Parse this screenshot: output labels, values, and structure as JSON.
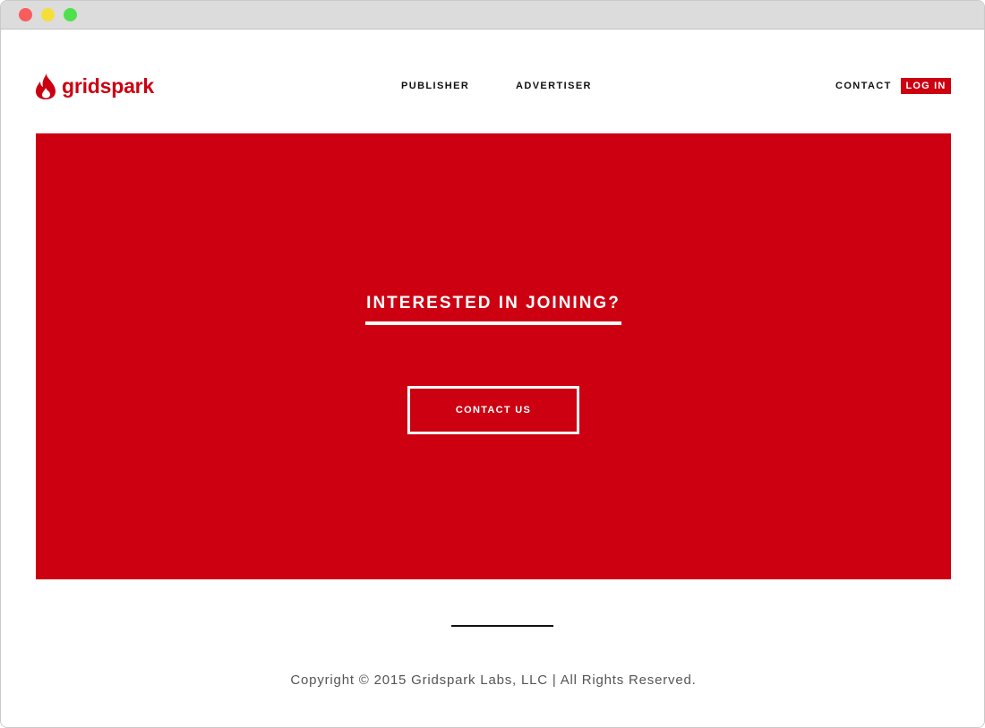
{
  "colors": {
    "brand_red": "#cc0011",
    "text_dark": "#111111",
    "text_muted": "#555555",
    "white": "#ffffff"
  },
  "header": {
    "logo_icon": "flame-icon",
    "logo_text": "gridspark",
    "nav": {
      "publisher": "PUBLISHER",
      "advertiser": "ADVERTISER",
      "contact": "CONTACT",
      "login": "LOG IN"
    }
  },
  "hero": {
    "heading": "INTERESTED IN JOINING?",
    "button_label": "CONTACT US"
  },
  "footer": {
    "copyright": "Copyright © 2015 Gridspark Labs, LLC | All Rights Reserved."
  }
}
